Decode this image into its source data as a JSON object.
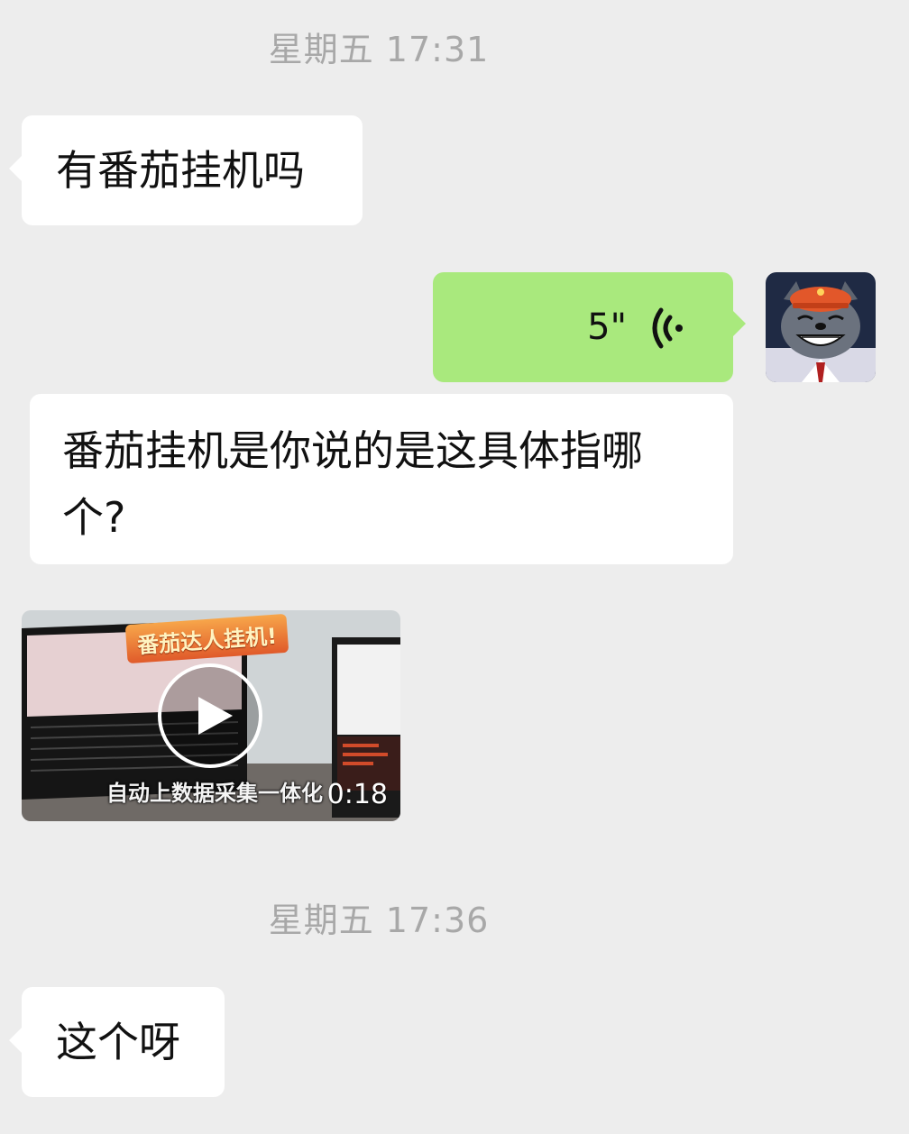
{
  "chat": {
    "timestamps": [
      "星期五 17:31",
      "星期五 17:36"
    ],
    "messages": [
      {
        "side": "left",
        "type": "text",
        "text": "有番茄挂机吗"
      },
      {
        "side": "right",
        "type": "voice",
        "duration": "5\""
      },
      {
        "side": "left",
        "type": "text",
        "text": "番茄挂机是你说的是这具体指哪个?"
      },
      {
        "side": "left",
        "type": "video",
        "duration": "0:18",
        "banner": "番茄达人挂机!",
        "caption": "自动上数据采集一体化"
      },
      {
        "side": "left",
        "type": "text",
        "text": "这个呀"
      }
    ]
  },
  "colors": {
    "background": "#ededed",
    "incoming_bubble": "#ffffff",
    "outgoing_bubble": "#a9e97d",
    "timestamp_text": "#a8a8a8"
  },
  "icons": {
    "voice": "voice-wave-icon",
    "play": "play-icon",
    "avatar": "wolf-avatar"
  }
}
